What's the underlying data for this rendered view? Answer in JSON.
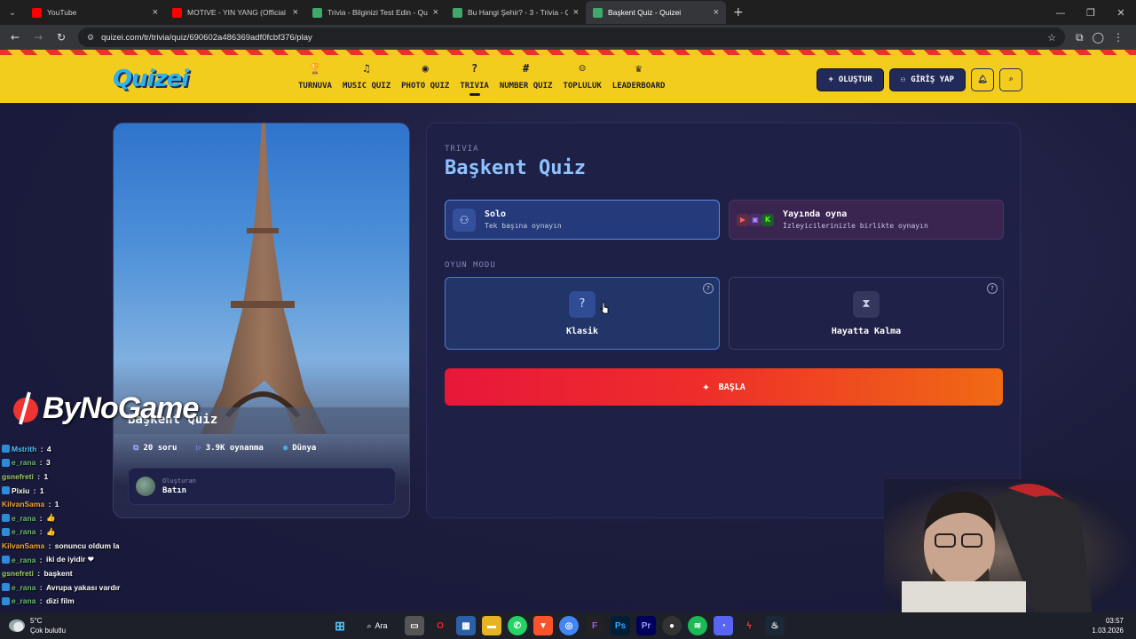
{
  "browser": {
    "tabs": [
      {
        "title": "YouTube",
        "favicon_color": "#ff0000",
        "active": false
      },
      {
        "title": "MOTIVE - YIN YANG (Official M",
        "favicon_color": "#ff0000",
        "active": false
      },
      {
        "title": "Trivia - Bilginizi Test Edin - Quiz",
        "favicon_color": "#3fa86a",
        "active": false
      },
      {
        "title": "Bu Hangi Şehir? - 3 - Trivia - Qu",
        "favicon_color": "#3fa86a",
        "active": false
      },
      {
        "title": "Başkent Quiz - Quizei",
        "favicon_color": "#3fa86a",
        "active": true
      }
    ],
    "url": "quizei.com/tr/trivia/quiz/690602a486369adf0fcbf376/play"
  },
  "site": {
    "logo": "Quizei",
    "nav": [
      {
        "label": "TURNUVA",
        "icon": "trophy-icon",
        "glyph": "🏆",
        "active": false
      },
      {
        "label": "MUSIC QUIZ",
        "icon": "music-icon",
        "glyph": "♫",
        "active": false
      },
      {
        "label": "PHOTO QUIZ",
        "icon": "camera-icon",
        "glyph": "◉",
        "active": false
      },
      {
        "label": "TRIVIA",
        "icon": "question-icon",
        "glyph": "?",
        "active": true
      },
      {
        "label": "NUMBER QUIZ",
        "icon": "hash-icon",
        "glyph": "#",
        "active": false
      },
      {
        "label": "TOPLULUK",
        "icon": "users-icon",
        "glyph": "☺",
        "active": false
      },
      {
        "label": "LEADERBOARD",
        "icon": "medal-icon",
        "glyph": "♛",
        "active": false
      }
    ],
    "create_label": "OLUŞTUR",
    "login_label": "GİRİŞ YAP"
  },
  "quiz_card": {
    "title": "Başkent Quiz",
    "questions": "20 soru",
    "plays": "3.9K oynanma",
    "region": "Dünya",
    "creator_label": "Oluşturan",
    "creator_name": "Batın"
  },
  "panel": {
    "category": "TRIVIA",
    "title": "Başkent Quiz",
    "solo_title": "Solo",
    "solo_sub": "Tek başına oynayın",
    "stream_title": "Yayında oyna",
    "stream_sub": "İzleyicilerinizle birlikte oynayın",
    "game_mode_label": "OYUN MODU",
    "mode_classic": "Klasik",
    "mode_survival": "Hayatta Kalma",
    "start_label": "BAŞLA"
  },
  "overlay": {
    "brand": "ByNoGame",
    "chat": [
      {
        "user": "Mstrith",
        "msg": "4",
        "color": "#4fc3f7",
        "badge": true
      },
      {
        "user": "e_rana",
        "msg": "3",
        "color": "#66bb6a",
        "badge": true
      },
      {
        "user": "gsnefreti",
        "msg": "1",
        "color": "#9ccc65",
        "badge": false
      },
      {
        "user": "Pixiu",
        "msg": "1",
        "color": "#ffffff",
        "badge": true
      },
      {
        "user": "KilvanSama",
        "msg": "1",
        "color": "#f0a830",
        "badge": false
      },
      {
        "user": "e_rana",
        "msg": "👍",
        "color": "#66bb6a",
        "badge": true
      },
      {
        "user": "e_rana",
        "msg": "👍",
        "color": "#66bb6a",
        "badge": true
      },
      {
        "user": "KilvanSama",
        "msg": "sonuncu oldum la",
        "color": "#f0a830",
        "badge": false
      },
      {
        "user": "e_rana",
        "msg": "iki de iyidir ❤",
        "color": "#66bb6a",
        "badge": true
      },
      {
        "user": "gsnefreti",
        "msg": "başkent",
        "color": "#9ccc65",
        "badge": false
      },
      {
        "user": "e_rana",
        "msg": "Avrupa yakası vardır",
        "color": "#66bb6a",
        "badge": true
      },
      {
        "user": "e_rana",
        "msg": "dizi film",
        "color": "#66bb6a",
        "badge": true
      }
    ]
  },
  "taskbar": {
    "temp": "5°C",
    "weather": "Çok bulutlu",
    "search_label": "Ara",
    "time": "03:57",
    "date": "1.03.2026"
  }
}
